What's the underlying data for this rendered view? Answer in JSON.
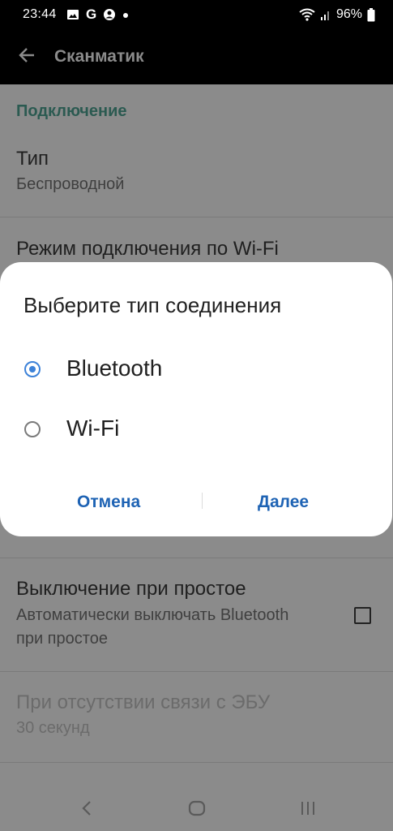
{
  "status_bar": {
    "time": "23:44",
    "g_label": "G",
    "battery": "96%"
  },
  "app_bar": {
    "title": "Сканматик"
  },
  "section": {
    "header": "Подключение"
  },
  "prefs": {
    "type": {
      "title": "Тип",
      "summary": "Беспроводной"
    },
    "wifi_mode": {
      "title": "Режим подключения по Wi-Fi"
    },
    "idle_off": {
      "title": "Выключение при простое",
      "summary": "Автоматически выключать Bluetooth при простое"
    },
    "no_ecu": {
      "title": "При отсутствии связи с ЭБУ",
      "summary": "30 секунд"
    }
  },
  "dialog": {
    "title": "Выберите тип соединения",
    "options": [
      {
        "label": "Bluetooth",
        "selected": true
      },
      {
        "label": "Wi-Fi",
        "selected": false
      }
    ],
    "cancel": "Отмена",
    "next": "Далее"
  },
  "colors": {
    "accent": "#3d82d8",
    "section": "#2b5a51",
    "dialog_button": "#1e63b4"
  },
  "icons": [
    "image-icon",
    "g-icon",
    "account-icon",
    "wifi-icon",
    "signal-icon",
    "battery-icon",
    "back-arrow-icon",
    "nav-back-icon",
    "nav-home-icon",
    "nav-recents-icon"
  ]
}
